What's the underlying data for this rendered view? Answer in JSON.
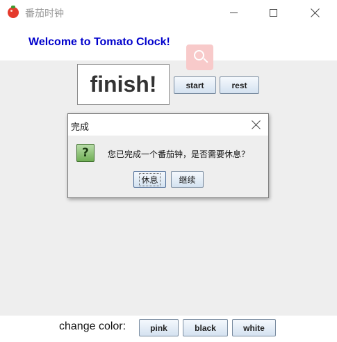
{
  "window": {
    "title": "番茄时钟",
    "app_icon": "tomato-icon",
    "controls": [
      "minimize-icon",
      "maximize-icon",
      "close-icon"
    ]
  },
  "header": {
    "welcome_text": "Welcome to Tomato Clock!",
    "welcome_color": "#0000cc"
  },
  "main": {
    "timer_text": "finish!",
    "start_label": "start",
    "rest_label": "rest",
    "search_badge_icon": "search-icon",
    "background": "#eeeeee"
  },
  "dialog": {
    "title": "完成",
    "icon": "question-icon",
    "message": "您已完成一个番茄钟，是否需要休息？",
    "rest_label": "休息",
    "continue_label": "继续"
  },
  "footer": {
    "change_color_label": "change color:",
    "pink_label": "pink",
    "black_label": "black",
    "white_label": "white"
  }
}
